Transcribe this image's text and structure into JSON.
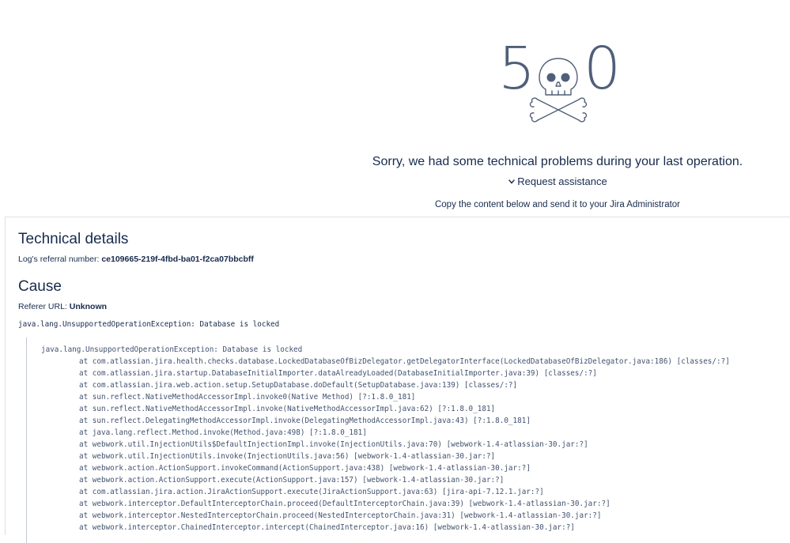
{
  "error": {
    "code_left": "5",
    "code_right": "0",
    "icon": "skull-crossbones-icon",
    "message": "Sorry, we had some technical problems during your last operation.",
    "request_label": "Request assistance",
    "copy_hint": "Copy the content below and send it to your Jira Administrator"
  },
  "details": {
    "heading": "Technical details",
    "referral_label": "Log's referral number:",
    "referral_number": "ce109665-219f-4fbd-ba01-f2ca07bbcbff",
    "cause_heading": "Cause",
    "referer_label": "Referer URL:",
    "referer_value": "Unknown",
    "exception": "java.lang.UnsupportedOperationException: Database is locked",
    "trace_head": "java.lang.UnsupportedOperationException: Database is locked",
    "trace_frames": [
      "at com.atlassian.jira.health.checks.database.LockedDatabaseOfBizDelegator.getDelegatorInterface(LockedDatabaseOfBizDelegator.java:186) [classes/:?]",
      "at com.atlassian.jira.startup.DatabaseInitialImporter.dataAlreadyLoaded(DatabaseInitialImporter.java:39) [classes/:?]",
      "at com.atlassian.jira.web.action.setup.SetupDatabase.doDefault(SetupDatabase.java:139) [classes/:?]",
      "at sun.reflect.NativeMethodAccessorImpl.invoke0(Native Method) [?:1.8.0_181]",
      "at sun.reflect.NativeMethodAccessorImpl.invoke(NativeMethodAccessorImpl.java:62) [?:1.8.0_181]",
      "at sun.reflect.DelegatingMethodAccessorImpl.invoke(DelegatingMethodAccessorImpl.java:43) [?:1.8.0_181]",
      "at java.lang.reflect.Method.invoke(Method.java:498) [?:1.8.0_181]",
      "at webwork.util.InjectionUtils$DefaultInjectionImpl.invoke(InjectionUtils.java:70) [webwork-1.4-atlassian-30.jar:?]",
      "at webwork.util.InjectionUtils.invoke(InjectionUtils.java:56) [webwork-1.4-atlassian-30.jar:?]",
      "at webwork.action.ActionSupport.invokeCommand(ActionSupport.java:438) [webwork-1.4-atlassian-30.jar:?]",
      "at webwork.action.ActionSupport.execute(ActionSupport.java:157) [webwork-1.4-atlassian-30.jar:?]",
      "at com.atlassian.jira.action.JiraActionSupport.execute(JiraActionSupport.java:63) [jira-api-7.12.1.jar:?]",
      "at webwork.interceptor.DefaultInterceptorChain.proceed(DefaultInterceptorChain.java:39) [webwork-1.4-atlassian-30.jar:?]",
      "at webwork.interceptor.NestedInterceptorChain.proceed(NestedInterceptorChain.java:31) [webwork-1.4-atlassian-30.jar:?]",
      "at webwork.interceptor.ChainedInterceptor.intercept(ChainedInterceptor.java:16) [webwork-1.4-atlassian-30.jar:?]"
    ]
  }
}
